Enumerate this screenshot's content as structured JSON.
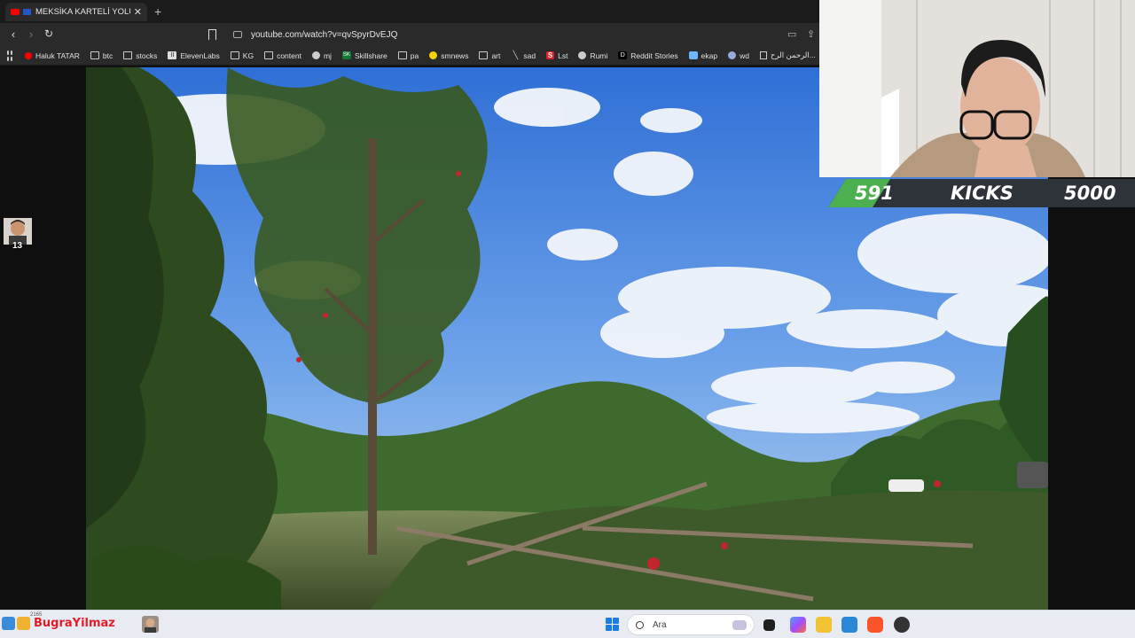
{
  "browser": {
    "tab": {
      "title": "MEKSİKA KARTELİ YOLUMUZU"
    },
    "url": "youtube.com/watch?v=qvSpyrDvEJQ",
    "bookmarks": [
      {
        "label": "Haluk TATAR",
        "icon": "youtube-icon"
      },
      {
        "label": "btc",
        "icon": "folder-icon"
      },
      {
        "label": "stocks",
        "icon": "folder-icon"
      },
      {
        "label": "ElevenLabs",
        "icon": "elevenlabs-icon"
      },
      {
        "label": "KG",
        "icon": "folder-icon"
      },
      {
        "label": "content",
        "icon": "folder-icon"
      },
      {
        "label": "mj",
        "icon": "github-icon"
      },
      {
        "label": "Skillshare",
        "icon": "skillshare-icon"
      },
      {
        "label": "pa",
        "icon": "folder-icon"
      },
      {
        "label": "smnews",
        "icon": "smiley-icon"
      },
      {
        "label": "art",
        "icon": "folder-icon"
      },
      {
        "label": "sad",
        "icon": "slash-icon"
      },
      {
        "label": "Lst",
        "icon": "s-icon"
      },
      {
        "label": "Rumi",
        "icon": "globe-icon"
      },
      {
        "label": "Reddit Stories",
        "icon": "d-icon"
      },
      {
        "label": "ekap",
        "icon": "bird-icon"
      },
      {
        "label": "wd",
        "icon": "wd-icon"
      },
      {
        "label": "الرحمن الرح...",
        "icon": "page-icon"
      }
    ]
  },
  "counter": {
    "current": "591",
    "label": "KICKS",
    "goal": "5000",
    "progress": 0.1182
  },
  "overlay": {
    "badge_number": "13"
  },
  "taskbar": {
    "username": "BugraYilmaz",
    "mini_number": "2165",
    "search_placeholder": "Ara"
  },
  "colors": {
    "accent_green": "#4caf50",
    "username_red": "#e31c2a",
    "youtube_red": "#ff0000"
  }
}
